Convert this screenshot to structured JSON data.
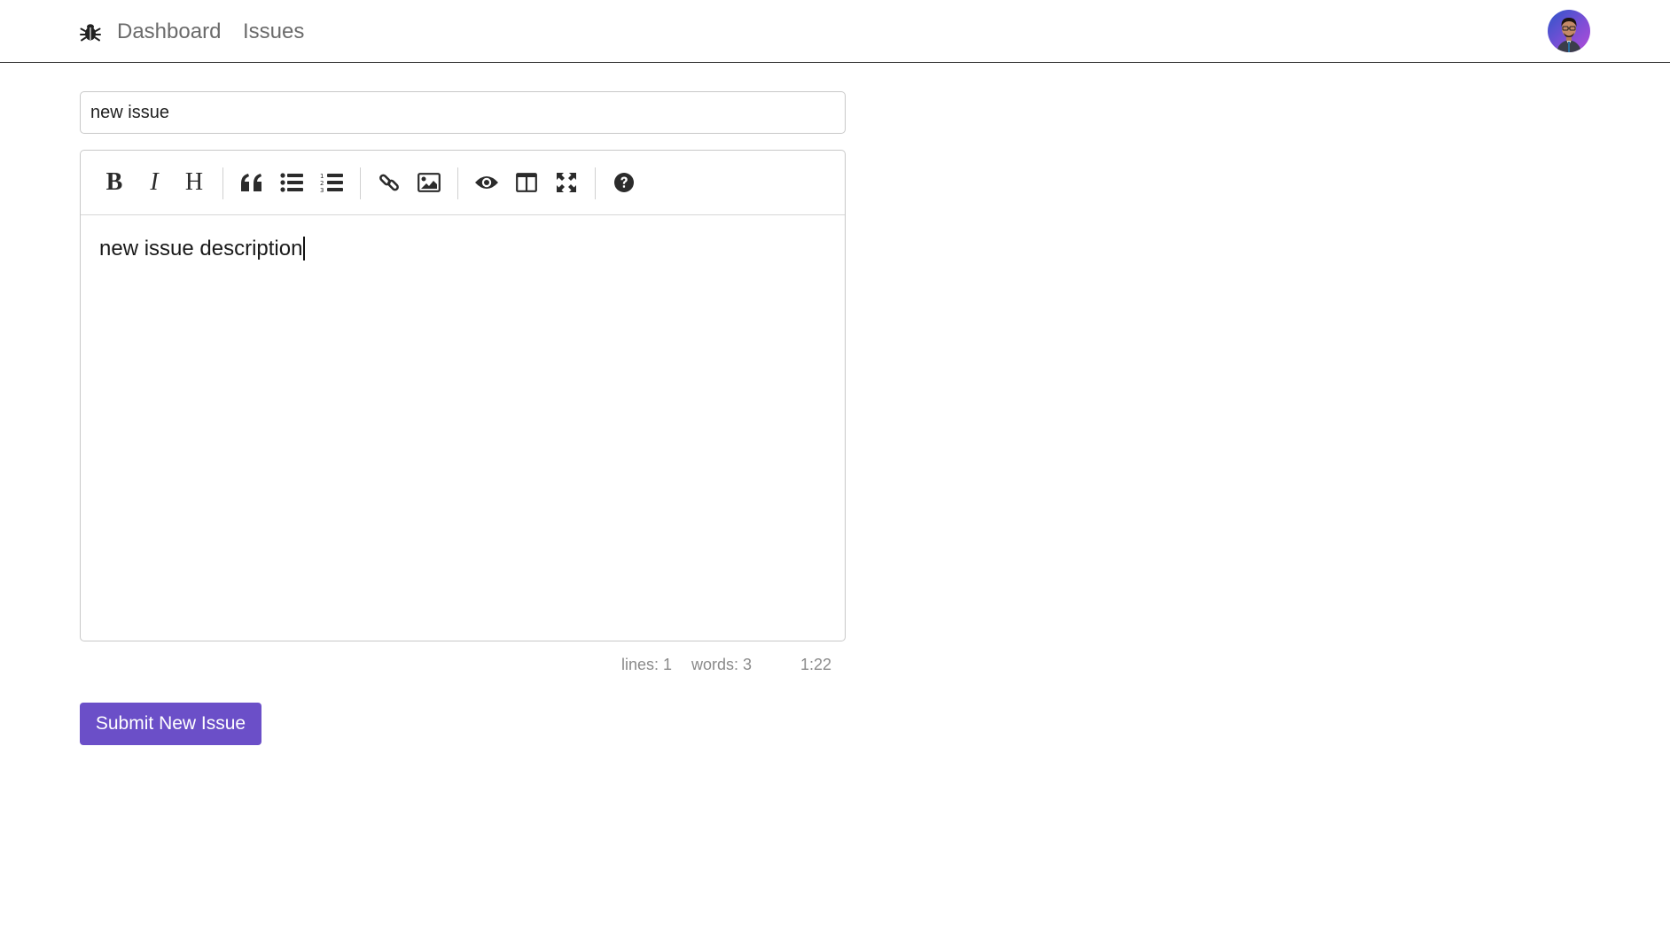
{
  "app": {
    "logo_icon": "bug-icon",
    "nav": {
      "dashboard_label": "Dashboard",
      "issues_label": "Issues"
    },
    "avatar_icon": "user-avatar"
  },
  "form": {
    "title_value": "new issue",
    "editor": {
      "content": "new issue description",
      "toolbar": [
        {
          "name": "bold",
          "icon": "bold-icon",
          "glyph": "B"
        },
        {
          "name": "italic",
          "icon": "italic-icon",
          "glyph": "I"
        },
        {
          "name": "heading",
          "icon": "heading-icon",
          "glyph": "H"
        },
        {
          "name": "quote",
          "icon": "quote-icon"
        },
        {
          "name": "unordered-list",
          "icon": "unordered-list-icon"
        },
        {
          "name": "ordered-list",
          "icon": "ordered-list-icon"
        },
        {
          "name": "link",
          "icon": "link-icon"
        },
        {
          "name": "image",
          "icon": "image-icon"
        },
        {
          "name": "preview",
          "icon": "eye-icon"
        },
        {
          "name": "side-by-side",
          "icon": "columns-icon"
        },
        {
          "name": "fullscreen",
          "icon": "expand-icon"
        },
        {
          "name": "guide",
          "icon": "question-circle-icon"
        }
      ],
      "status": {
        "lines": "lines: 1",
        "words": "words: 3",
        "cursor": "1:22"
      }
    },
    "submit_label": "Submit New Issue"
  },
  "colors": {
    "accent": "#6b4fc8",
    "nav_text": "#6b6b6b",
    "status_text": "#8a8a8a"
  }
}
